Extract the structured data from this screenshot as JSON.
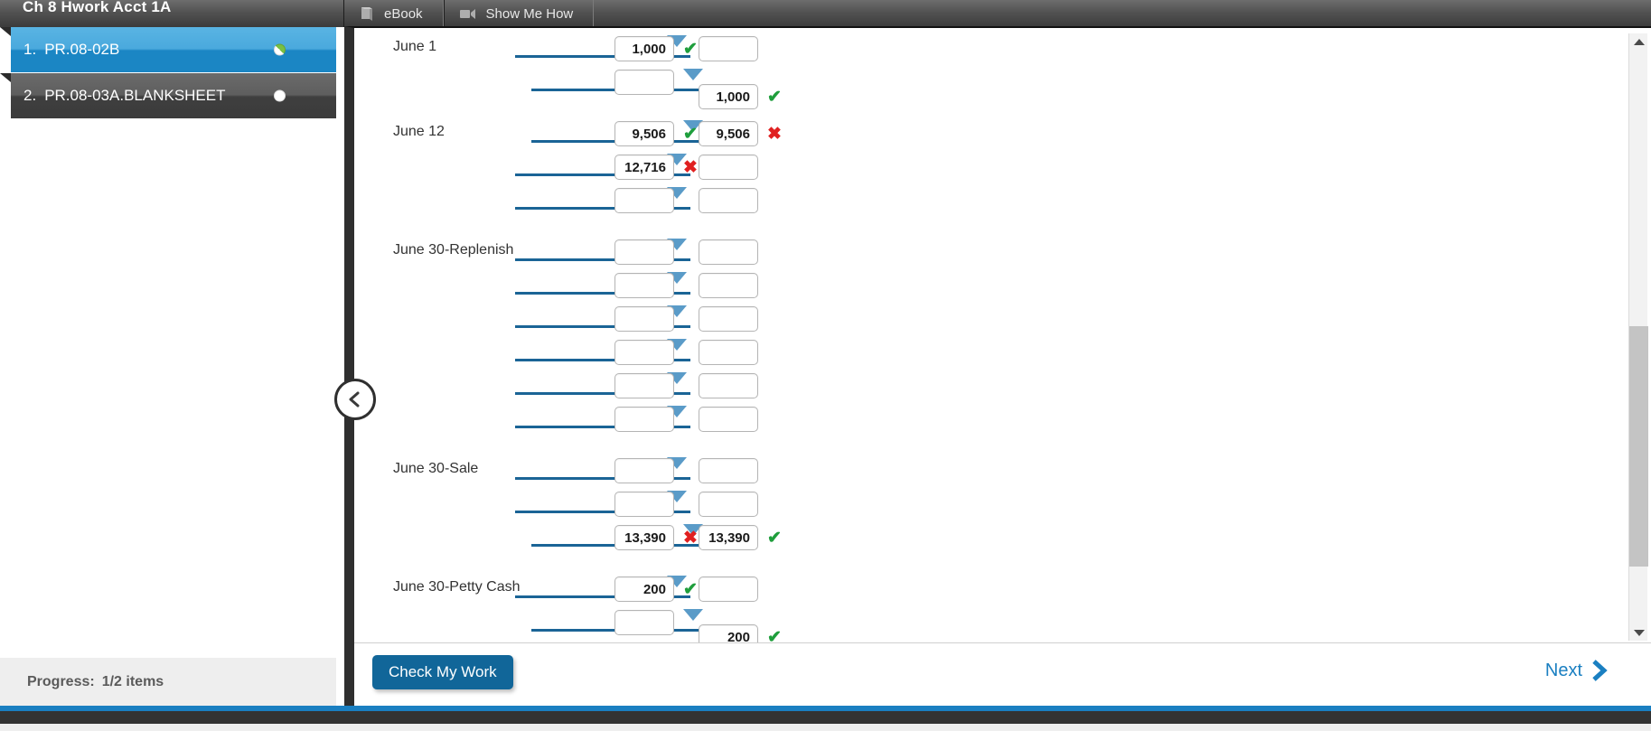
{
  "header": {
    "course_title": "Ch 8 Hwork Acct 1A",
    "tabs": [
      {
        "label": "eBook",
        "icon": "book-icon"
      },
      {
        "label": "Show Me How",
        "icon": "video-camera-icon"
      }
    ]
  },
  "sidebar": {
    "items": [
      {
        "number": "1.",
        "label": "PR.08-02B",
        "status": "partial",
        "active": true
      },
      {
        "number": "2.",
        "label": "PR.08-03A.BLANKSHEET",
        "status": "empty",
        "active": false
      }
    ],
    "progress_label": "Progress:",
    "progress_value": "1/2 items"
  },
  "journal": {
    "groups": [
      {
        "date": "June 1",
        "rows": [
          {
            "indent": 0,
            "debit": "1,000",
            "debit_mark": "ok",
            "credit": "",
            "credit_mark": "",
            "credit_lowered": false
          },
          {
            "indent": 1,
            "debit": "",
            "debit_mark": "",
            "credit": "1,000",
            "credit_mark": "ok",
            "credit_lowered": true
          }
        ]
      },
      {
        "date": "June 12",
        "rows": [
          {
            "indent": 1,
            "debit": "9,506",
            "debit_mark": "ok",
            "credit": "9,506",
            "credit_mark": "bad",
            "credit_lowered": false
          },
          {
            "indent": 0,
            "debit": "12,716",
            "debit_mark": "bad",
            "credit": "",
            "credit_mark": "",
            "credit_lowered": false
          },
          {
            "indent": 0,
            "debit": "",
            "debit_mark": "",
            "credit": "",
            "credit_mark": "",
            "credit_lowered": false
          }
        ]
      },
      {
        "date": "June 30-Replenish",
        "rows": [
          {
            "indent": 0,
            "debit": "",
            "debit_mark": "",
            "credit": "",
            "credit_mark": "",
            "credit_lowered": false
          },
          {
            "indent": 0,
            "debit": "",
            "debit_mark": "",
            "credit": "",
            "credit_mark": "",
            "credit_lowered": false
          },
          {
            "indent": 0,
            "debit": "",
            "debit_mark": "",
            "credit": "",
            "credit_mark": "",
            "credit_lowered": false
          },
          {
            "indent": 0,
            "debit": "",
            "debit_mark": "",
            "credit": "",
            "credit_mark": "",
            "credit_lowered": false
          },
          {
            "indent": 0,
            "debit": "",
            "debit_mark": "",
            "credit": "",
            "credit_mark": "",
            "credit_lowered": false
          },
          {
            "indent": 0,
            "debit": "",
            "debit_mark": "",
            "credit": "",
            "credit_mark": "",
            "credit_lowered": false
          }
        ]
      },
      {
        "date": "June 30-Sale",
        "rows": [
          {
            "indent": 0,
            "debit": "",
            "debit_mark": "",
            "credit": "",
            "credit_mark": "",
            "credit_lowered": false
          },
          {
            "indent": 0,
            "debit": "",
            "debit_mark": "",
            "credit": "",
            "credit_mark": "",
            "credit_lowered": false
          },
          {
            "indent": 1,
            "debit": "13,390",
            "debit_mark": "bad",
            "credit": "13,390",
            "credit_mark": "ok",
            "credit_lowered": false
          }
        ]
      },
      {
        "date": "June 30-Petty Cash",
        "rows": [
          {
            "indent": 0,
            "debit": "200",
            "debit_mark": "ok",
            "credit": "",
            "credit_mark": "",
            "credit_lowered": false
          },
          {
            "indent": 1,
            "debit": "",
            "debit_mark": "",
            "credit": "200",
            "credit_mark": "ok",
            "credit_lowered": true
          }
        ]
      }
    ]
  },
  "actions": {
    "check_label": "Check My Work",
    "next_label": "Next"
  },
  "colors": {
    "accent_blue": "#1a7fc1",
    "button_blue": "#116699",
    "underline_blue": "#1a6496",
    "caret_blue": "#5a9bc8",
    "correct_green": "#1f9e3c",
    "incorrect_red": "#e02020",
    "active_nav": "#1b86c4",
    "chrome_dark": "#3b3b3b"
  },
  "scrollbar": {
    "up_icon": "triangle-up-icon",
    "down_icon": "triangle-down-icon"
  }
}
